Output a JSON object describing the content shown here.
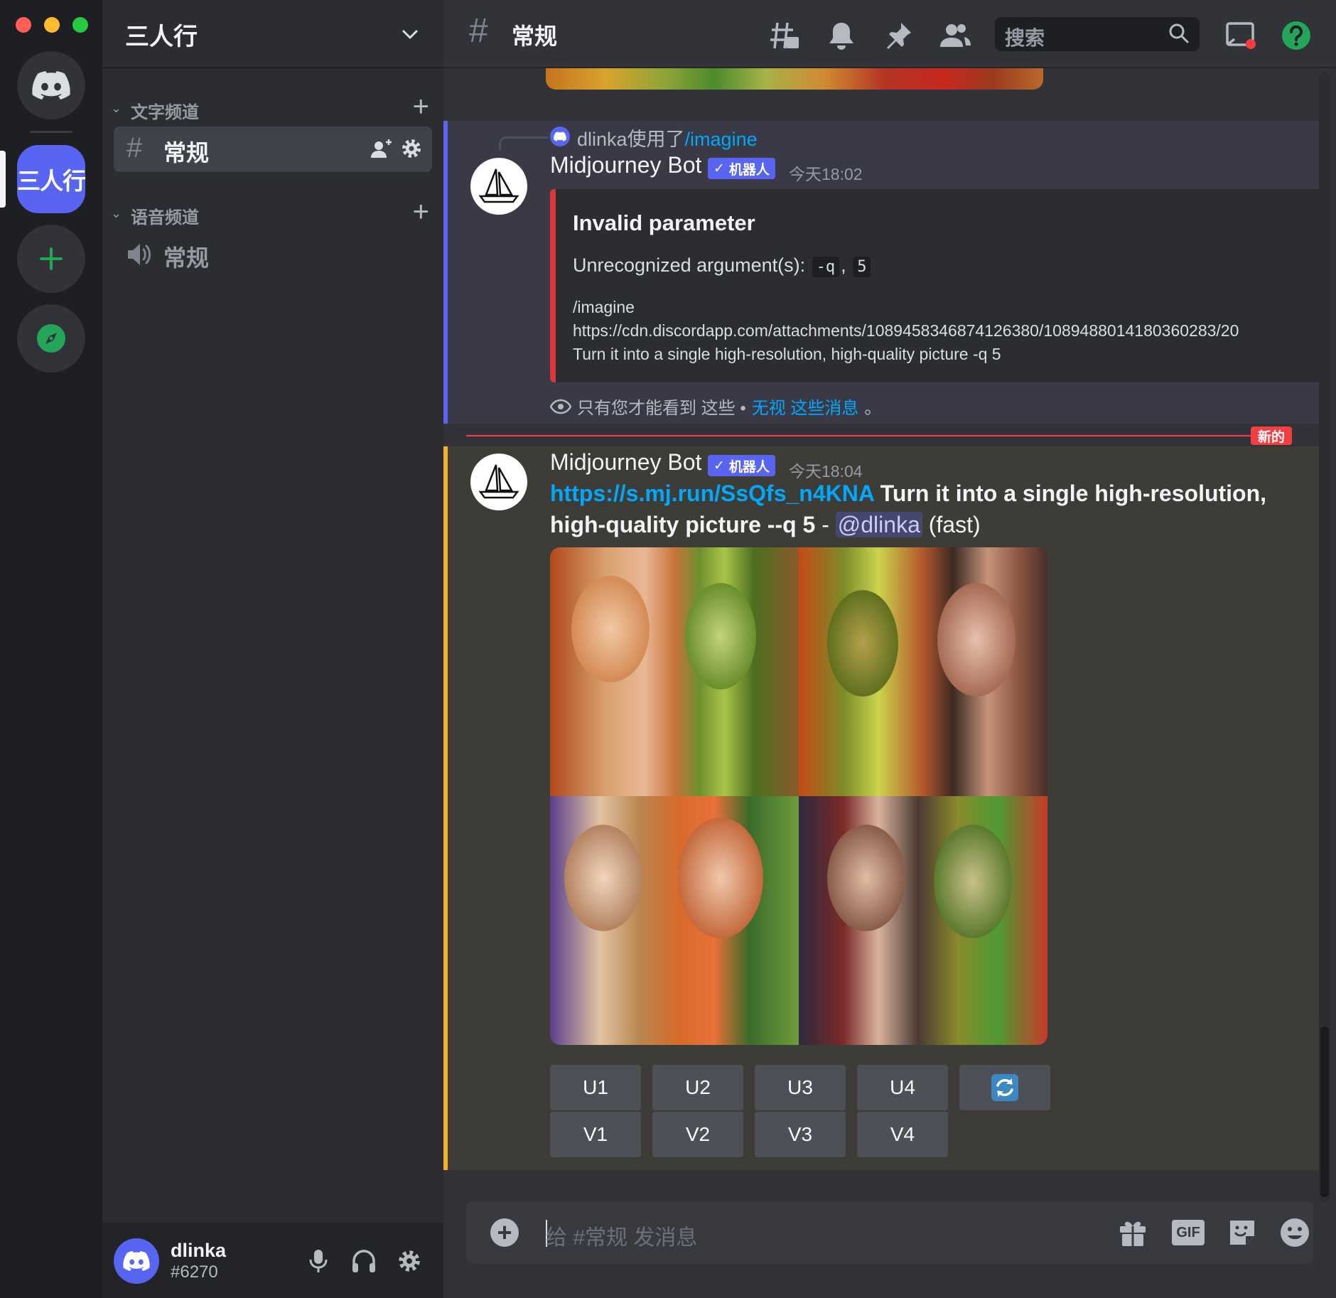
{
  "window": {
    "traffic_colors": [
      "#ff5f57",
      "#febc2e",
      "#28c840"
    ]
  },
  "rail": {
    "home_icon": "discord-logo-icon",
    "active_server": {
      "label": "三人行"
    },
    "add_server_icon": "plus-icon",
    "explore_icon": "compass-icon"
  },
  "sidebar": {
    "guild_name": "三人行",
    "text_category": "文字频道",
    "text_channel": "常规",
    "voice_category": "语音频道",
    "voice_channel": "常规"
  },
  "user": {
    "name": "dlinka",
    "tag": "#6270"
  },
  "topbar": {
    "channel_name": "常规",
    "search_placeholder": "搜索"
  },
  "message1": {
    "reply_user": "dlinka使用了",
    "reply_command": "/imagine",
    "author": "Midjourney Bot",
    "bot_tag": "机器人",
    "timestamp": "今天18:02",
    "embed_title": "Invalid parameter",
    "embed_desc_prefix": "Unrecognized argument(s):",
    "arg1": "-q",
    "arg_sep": ",",
    "arg2": "5",
    "body_line1": "/imagine",
    "body_line2": "https://cdn.discordapp.com/attachments/1089458346874126380/1089488014180360283/20",
    "body_line3": "Turn it into a single high-resolution, high-quality picture -q 5",
    "only_you": "只有您才能看到 这些 •",
    "dismiss": "无视 这些消息",
    "period": "。"
  },
  "divider": {
    "label": "新的"
  },
  "message2": {
    "author": "Midjourney Bot",
    "bot_tag": "机器人",
    "timestamp": "今天18:04",
    "url": "https://s.mj.run/SsQfs_n4KNA",
    "prompt_part1": " Turn it into a single high-resolution,",
    "prompt_part2": "high-quality picture --q 5",
    "dash": " - ",
    "mention": "@dlinka",
    "speed": " (fast)",
    "upscale_buttons": [
      "U1",
      "U2",
      "U3",
      "U4"
    ],
    "variation_buttons": [
      "V1",
      "V2",
      "V3",
      "V4"
    ],
    "reroll_icon": "refresh-icon"
  },
  "composer": {
    "placeholder": "给 #常规 发消息",
    "icons": [
      "gift-icon",
      "gif-icon",
      "sticker-icon",
      "emoji-icon"
    ],
    "gif_label": "GIF"
  },
  "colors": {
    "blurple": "#5865f2",
    "link": "#00a8fc",
    "error": "#da373c",
    "highlight": "#f0b232",
    "new_badge": "#f23f43",
    "online": "#23a55a"
  }
}
